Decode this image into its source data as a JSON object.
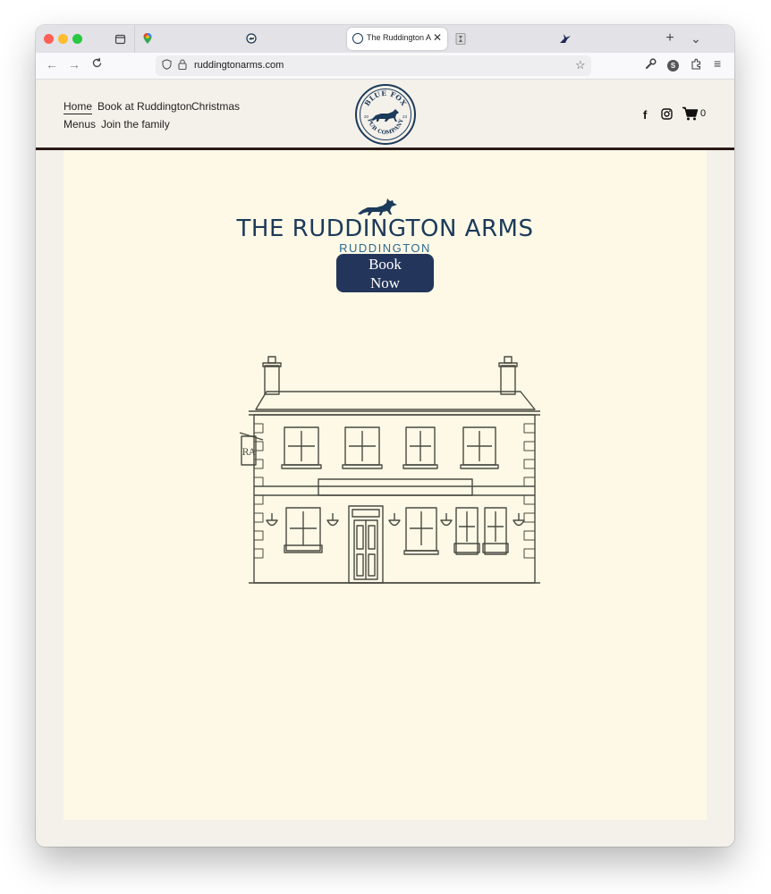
{
  "browser": {
    "active_tab_title": "The Ruddington Arms",
    "url": "ruddingtonarms.com",
    "tab_icons": [
      "tab-overview-icon",
      "maps-pin-icon",
      "blue-fox-icon",
      "blue-fox-icon",
      "hourglass-icon",
      "bird-icon"
    ],
    "toolbar_icons": [
      "back-arrow-icon",
      "forward-arrow-icon",
      "reload-icon",
      "shield-icon",
      "lock-icon",
      "star-icon",
      "wrench-icon",
      "account-icon",
      "extensions-icon",
      "menu-icon"
    ],
    "new_tab": "+",
    "tab_list": "⌄",
    "account_initial": "S"
  },
  "site": {
    "nav": [
      {
        "label": "Home",
        "active": true
      },
      {
        "label": "Book at Ruddington"
      },
      {
        "label": "Christmas"
      },
      {
        "label": "Menus"
      },
      {
        "label": "Join the family"
      }
    ],
    "logo": {
      "top": "BLUE FOX",
      "bottom": "PUB COMPANY",
      "left_num": "20",
      "right_num": "23"
    },
    "social": {
      "facebook": "f",
      "cart_count": "0"
    },
    "brand_title": "THE RUDDINGTON ARMS",
    "brand_subtitle": "RUDDINGTON",
    "book_button": "Book Now",
    "sign_text": "RA"
  },
  "colors": {
    "navy": "#1c3a5a",
    "button": "#23355a",
    "content_bg": "#fdf9e6",
    "page_bg": "#f4f1ea",
    "header_rule": "#2b1a17"
  }
}
